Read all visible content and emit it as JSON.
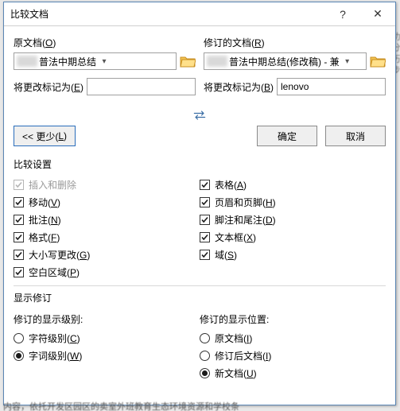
{
  "titlebar": {
    "title": "比较文档",
    "help": "?",
    "close": "✕"
  },
  "original": {
    "group": "原文档(",
    "group_u": "O",
    "group_end": ")",
    "file": "普法中期总结",
    "mark_label": "将更改标记为(",
    "mark_u": "E",
    "mark_end": ")",
    "mark_value": ""
  },
  "revised": {
    "group": "修订的文档(",
    "group_u": "R",
    "group_end": ")",
    "file": "普法中期总结(修改稿)  -  兼",
    "mark_label": "将更改标记为(",
    "mark_u": "B",
    "mark_end": ")",
    "mark_value": "lenovo"
  },
  "buttons": {
    "less": "<< 更少(",
    "less_u": "L",
    "less_end": ")",
    "ok": "确定",
    "cancel": "取消"
  },
  "compare": {
    "title": "比较设置",
    "left": [
      {
        "label": "插入和删除",
        "u": "",
        "checked": true,
        "disabled": true
      },
      {
        "label": "移动(",
        "u": "V",
        "end": ")",
        "checked": true
      },
      {
        "label": "批注(",
        "u": "N",
        "end": ")",
        "checked": true
      },
      {
        "label": "格式(",
        "u": "F",
        "end": ")",
        "checked": true
      },
      {
        "label": "大小写更改(",
        "u": "G",
        "end": ")",
        "checked": true
      },
      {
        "label": "空白区域(",
        "u": "P",
        "end": ")",
        "checked": true
      }
    ],
    "right": [
      {
        "label": "表格(",
        "u": "A",
        "end": ")",
        "checked": true
      },
      {
        "label": "页眉和页脚(",
        "u": "H",
        "end": ")",
        "checked": true
      },
      {
        "label": "脚注和尾注(",
        "u": "D",
        "end": ")",
        "checked": true
      },
      {
        "label": "文本框(",
        "u": "X",
        "end": ")",
        "checked": true
      },
      {
        "label": "域(",
        "u": "S",
        "end": ")",
        "checked": true
      }
    ]
  },
  "show": {
    "title": "显示修订",
    "level_title": "修订的显示级别:",
    "levels": [
      {
        "label": "字符级别(",
        "u": "C",
        "end": ")",
        "selected": false
      },
      {
        "label": "字词级别(",
        "u": "W",
        "end": ")",
        "selected": true
      }
    ],
    "pos_title": "修订的显示位置:",
    "positions": [
      {
        "label": "原文档(",
        "u": "I",
        "end": ")",
        "selected": false
      },
      {
        "label": "修订后文档(",
        "u": "I",
        "end": ")",
        "selected": false
      },
      {
        "label": "新文档(",
        "u": "U",
        "end": ")",
        "selected": true
      }
    ]
  },
  "bgtext": "内容，依托开发区园区的卖室外班教育生态环境资源和学校条"
}
